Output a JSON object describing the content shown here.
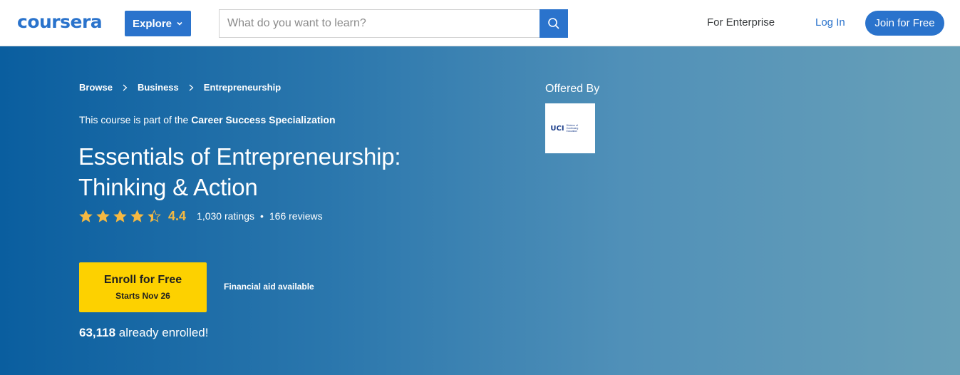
{
  "header": {
    "logo_text": "coursera",
    "explore_label": "Explore",
    "search_placeholder": "What do you want to learn?",
    "enterprise_label": "For Enterprise",
    "login_label": "Log In",
    "join_label": "Join for Free"
  },
  "breadcrumb": [
    "Browse",
    "Business",
    "Entrepreneurship"
  ],
  "course": {
    "spec_prefix": "This course is part of the ",
    "spec_name": "Career Success Specialization",
    "title_line1": "Essentials of Entrepreneurship:",
    "title_line2": "Thinking & Action",
    "rating": "4.4",
    "rating_value": 4.4,
    "ratings_count": "1,030 ratings",
    "dot": "•",
    "reviews_count": "166 reviews",
    "enroll_label": "Enroll for Free",
    "enroll_sub": "Starts Nov 26",
    "financial_aid": "Financial aid available",
    "enrolled_count": "63,118",
    "enrolled_suffix": " already enrolled!"
  },
  "offered": {
    "label": "Offered By",
    "partner_abbr": "UCI",
    "partner_division": "Division of Continuing Education"
  },
  "colors": {
    "brand_blue": "#2a73cc",
    "hero_start": "#0a5e9f",
    "hero_end": "#68a0b8",
    "enroll_yellow": "#fdd100",
    "star_gold": "#f5b942"
  }
}
